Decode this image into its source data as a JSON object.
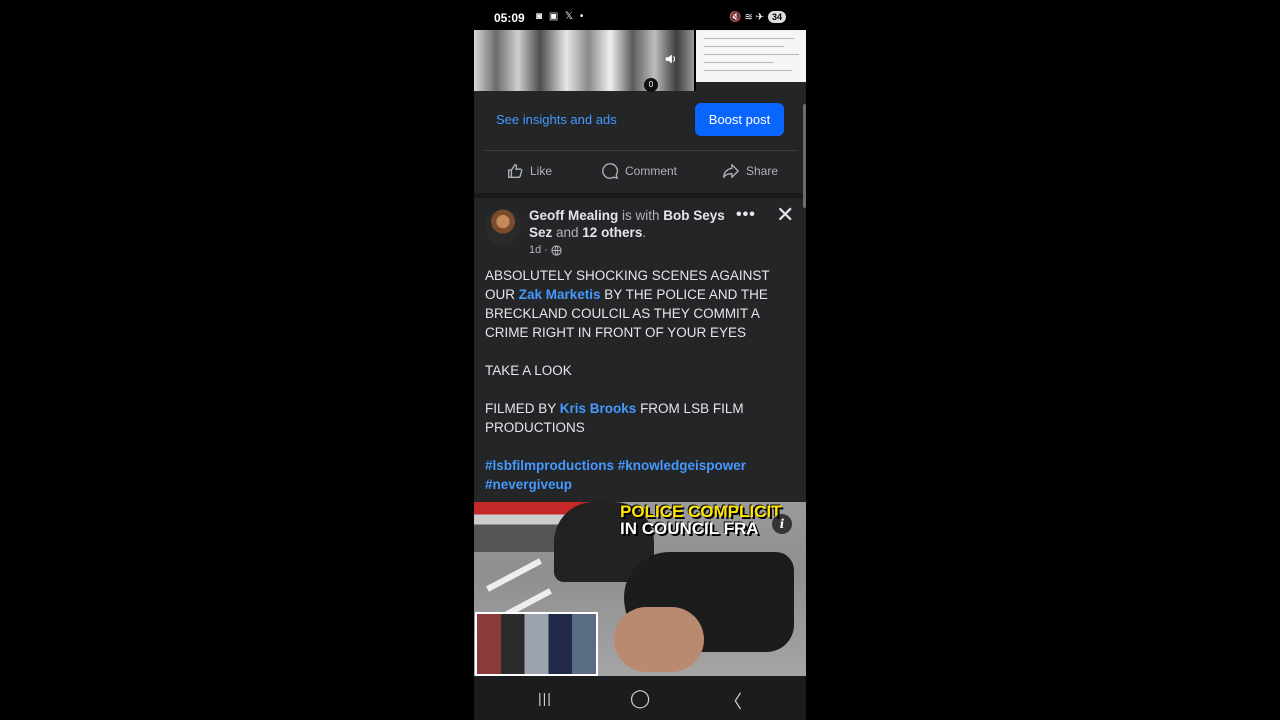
{
  "status_bar": {
    "time": "05:09",
    "left_icons": "◙ ▣ 𝕏 •",
    "right_icons": "🔇 ≋ ✈",
    "battery": "34"
  },
  "thumbnail": {
    "counter": "0",
    "speaker_icon": "speaker-icon"
  },
  "insights_link": "See insights and ads",
  "boost_button": "Boost post",
  "action_bar": {
    "like": "Like",
    "comment": "Comment",
    "share": "Share"
  },
  "post": {
    "author": "Geoff Mealing",
    "is_with": " is with ",
    "tagged": "Bob Seys Sez",
    "and": " and ",
    "others": "12 others",
    "period": ".",
    "time": "1d",
    "dot": "·",
    "body": {
      "p1_a": "ABSOLUTELY SHOCKING SCENES AGAINST OUR ",
      "p1_link": "Zak Marketis",
      "p1_b": " BY THE POLICE AND THE BRECKLAND COULCIL AS THEY COMMIT A CRIME RIGHT IN FRONT OF YOUR EYES",
      "p2": "TAKE A LOOK",
      "p3_a": "FILMED BY ",
      "p3_link": "Kris Brooks",
      "p3_b": " FROM LSB FILM PRODUCTIONS",
      "tag1": "#lsbfilmproductions",
      "tag2": "#knowledgeispower",
      "tag3": "#nevergiveup"
    },
    "video": {
      "overlay_line1": "POLICE COMPLICIT",
      "overlay_line2": "IN COUNCIL FRA",
      "info": "i"
    }
  },
  "nav_bar": {
    "recents": "|||",
    "home": "◯",
    "back": "〈"
  },
  "colors": {
    "background": "#242526",
    "link": "#4599ff",
    "boost": "#0866ff",
    "text": "#e4e6eb",
    "muted": "#b0b3b8"
  }
}
